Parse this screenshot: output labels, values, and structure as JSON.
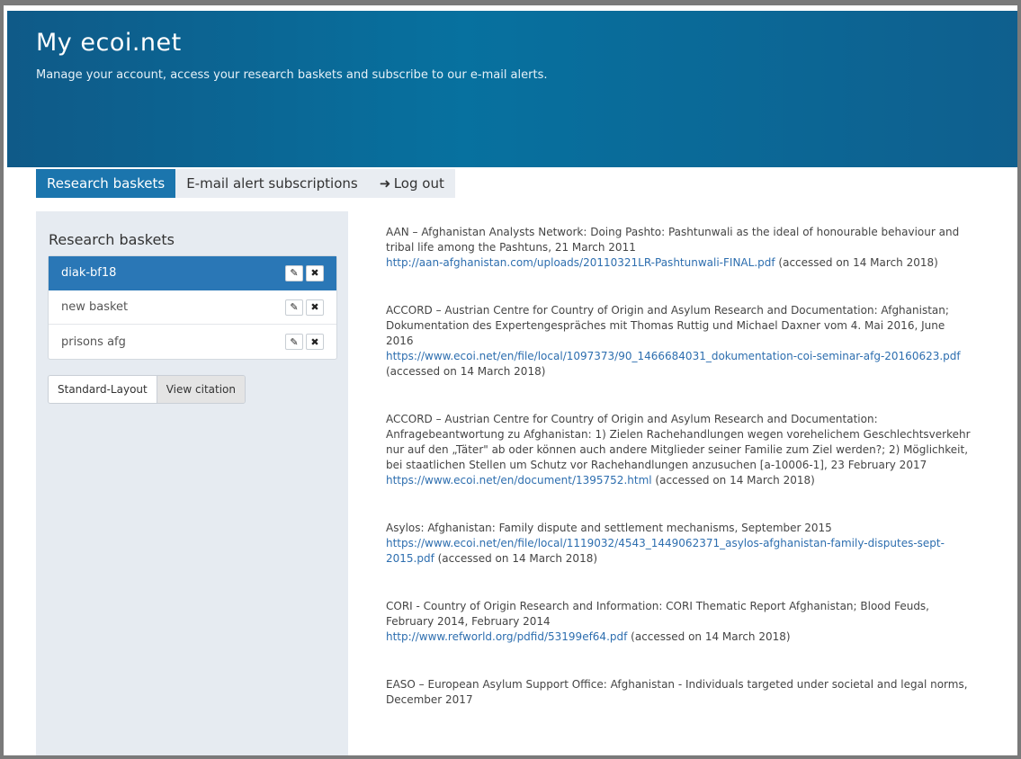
{
  "header": {
    "title": "My ecoi.net",
    "subtitle": "Manage your account, access your research baskets and subscribe to our e-mail alerts."
  },
  "tabs": [
    {
      "label": "Research baskets"
    },
    {
      "label": "E-mail alert subscriptions"
    },
    {
      "label": "Log out"
    }
  ],
  "sidebar": {
    "heading": "Research baskets",
    "baskets": [
      {
        "name": "diak-bf18"
      },
      {
        "name": "new basket"
      },
      {
        "name": "prisons afg"
      }
    ],
    "layout_buttons": {
      "standard": "Standard-Layout",
      "citation": "View citation"
    }
  },
  "citations": [
    {
      "text": "AAN – Afghanistan Analysts Network: Doing Pashto: Pashtunwali as the ideal of honourable behaviour and tribal life among the Pashtuns, 21 March 2011",
      "link": "http://aan-afghanistan.com/uploads/20110321LR-Pashtunwali-FINAL.pdf",
      "accessed": " (accessed on 14 March 2018)"
    },
    {
      "text": "ACCORD – Austrian Centre for Country of Origin and Asylum Research and Documentation: Afghanistan; Dokumentation des Expertengespräches mit Thomas Ruttig und Michael Daxner vom 4. Mai 2016, June 2016",
      "link": "https://www.ecoi.net/en/file/local/1097373/90_1466684031_dokumentation-coi-seminar-afg-20160623.pdf",
      "accessed": " (accessed on 14 March 2018)"
    },
    {
      "text": "ACCORD – Austrian Centre for Country of Origin and Asylum Research and Documentation: Anfragebeantwortung zu Afghanistan: 1) Zielen Rachehandlungen wegen vorehelichem Geschlechtsverkehr nur auf den „Täter\" ab oder können auch andere Mitglieder seiner Familie zum Ziel werden?; 2) Möglichkeit, bei staatlichen Stellen um Schutz vor Rachehandlungen anzusuchen [a-10006-1], 23 February 2017",
      "link": "https://www.ecoi.net/en/document/1395752.html",
      "accessed": " (accessed on 14 March 2018)"
    },
    {
      "text": "Asylos: Afghanistan: Family dispute and settlement mechanisms, September 2015",
      "link": "https://www.ecoi.net/en/file/local/1119032/4543_1449062371_asylos-afghanistan-family-disputes-sept-2015.pdf",
      "accessed": " (accessed on 14 March 2018)"
    },
    {
      "text": "CORI - Country of Origin Research and Information: CORI Thematic Report Afghanistan; Blood Feuds, February 2014, February 2014",
      "link": "http://www.refworld.org/pdfid/53199ef64.pdf",
      "accessed": " (accessed on 14 March 2018)"
    },
    {
      "text": "EASO – European Asylum Support Office: Afghanistan - Individuals targeted under societal and legal norms, December 2017",
      "link": "",
      "accessed": ""
    }
  ],
  "icons": {
    "edit": "pencil-icon",
    "delete": "close-icon",
    "logout": "logout-icon"
  },
  "colors": {
    "header": "#07719f",
    "accent": "#1b75ad",
    "link": "#2d6eaf",
    "sidebar": "#e6ebf1"
  }
}
